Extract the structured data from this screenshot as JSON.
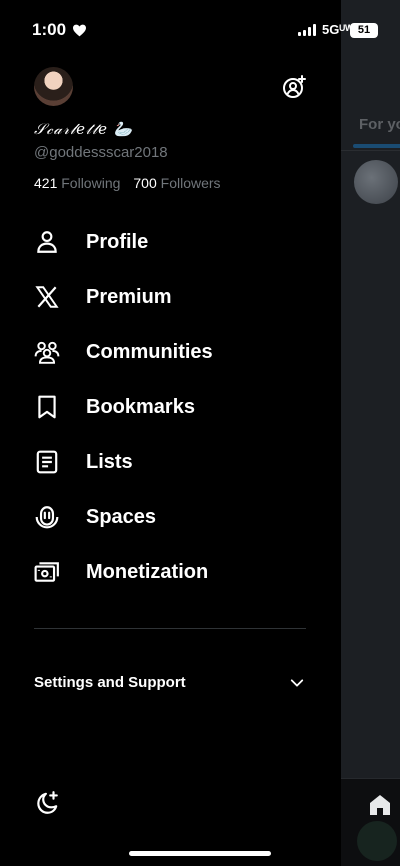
{
  "status_bar": {
    "time": "1:00",
    "network": "5Gᵁᵂ",
    "battery": "51"
  },
  "profile": {
    "display_name": "𝒮𝒸𝒶𝓇𝓁𝑒𝓉𝓉𝑒 🦢",
    "handle": "@goddessscar2018",
    "following_count": "421",
    "following_label": "Following",
    "followers_count": "700",
    "followers_label": "Followers"
  },
  "menu": {
    "items": [
      {
        "label": "Profile",
        "icon": "person-icon"
      },
      {
        "label": "Premium",
        "icon": "x-logo-icon"
      },
      {
        "label": "Communities",
        "icon": "communities-icon"
      },
      {
        "label": "Bookmarks",
        "icon": "bookmark-icon"
      },
      {
        "label": "Lists",
        "icon": "list-icon"
      },
      {
        "label": "Spaces",
        "icon": "spaces-icon"
      },
      {
        "label": "Monetization",
        "icon": "money-icon"
      }
    ]
  },
  "settings": {
    "label": "Settings and Support"
  },
  "timeline_peek": {
    "tab_label": "For yo"
  },
  "colors": {
    "background": "#000000",
    "text": "#ffffff",
    "muted": "#71767b",
    "accent": "#1d9bf0"
  }
}
